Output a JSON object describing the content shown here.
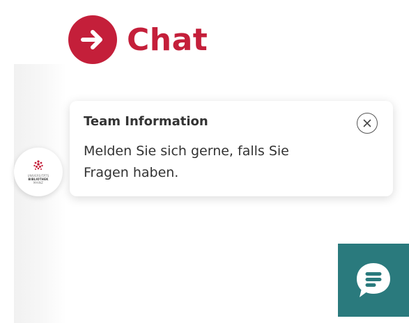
{
  "heading": {
    "title": "Chat",
    "icon": "arrow-right-icon",
    "accent_color": "#c41f3a"
  },
  "avatar": {
    "logo_lines": [
      "UNIVERSITÄTS",
      "BIBLIOTHEK",
      "MAINZ"
    ]
  },
  "notice": {
    "title": "Team Information",
    "line1": "Melden Sie sich gerne, falls Sie",
    "line2": "Fragen haben.",
    "close_icon": "close-icon"
  },
  "launcher": {
    "icon": "chat-bubble-icon",
    "color": "#2a7a7d"
  }
}
